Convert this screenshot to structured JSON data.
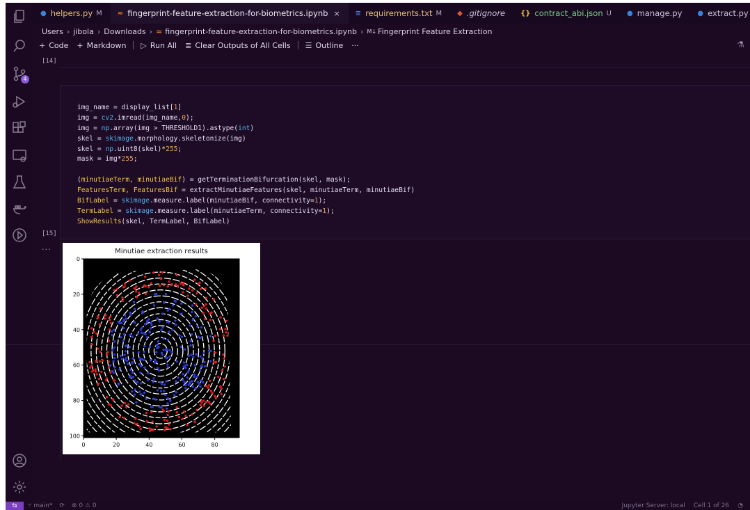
{
  "tabs": [
    {
      "label": "helpers.py",
      "icon": "python-icon",
      "icon_color": "#3b82d6",
      "status": "M",
      "active": false
    },
    {
      "label": "fingerprint-feature-extraction-for-biometrics.ipynb",
      "icon": "jupyter-icon",
      "icon_color": "#e07b2a",
      "status": "",
      "active": true,
      "closable": true
    },
    {
      "label": "requirements.txt",
      "icon": "requirements-icon",
      "icon_color": "#4a7dd4",
      "status": "M",
      "active": false
    },
    {
      "label": ".gitignore",
      "icon": "git-icon",
      "icon_color": "#e0583a",
      "status": "",
      "active": false,
      "italic": true
    },
    {
      "label": "contract_abi.json",
      "icon": "json-icon",
      "icon_color": "#e8c23a",
      "status": "U",
      "active": false
    },
    {
      "label": "manage.py",
      "icon": "python-icon",
      "icon_color": "#3b82d6",
      "status": "",
      "active": false
    },
    {
      "label": "extract.py",
      "icon": "python-icon",
      "icon_color": "#3b82d6",
      "status": "",
      "active": false
    }
  ],
  "tab_close_glyph": "×",
  "breadcrumb": {
    "parts": [
      "Users",
      "jibola",
      "Downloads",
      "fingerprint-feature-extraction-for-biometrics.ipynb"
    ],
    "section_prefix": "M↓",
    "section": "Fingerprint Feature Extraction"
  },
  "toolbar": {
    "code": "Code",
    "markdown": "Markdown",
    "run_all": "Run All",
    "clear": "Clear Outputs of All Cells",
    "outline": "Outline",
    "more": "···"
  },
  "cells": {
    "prompt_14": "[14]",
    "prompt_15": "[15]",
    "output_more": "···"
  },
  "code_lines": [
    "img_name = display_list[1]",
    "img = cv2.imread(img_name,0);",
    "img = np.array(img > THRESHOLD1).astype(int)",
    "skel = skimage.morphology.skeletonize(img)",
    "skel = np.uint8(skel)*255;",
    "mask = img*255;",
    "",
    "(minutiaeTerm, minutiaeBif) = getTerminationBifurcation(skel, mask);",
    "FeaturesTerm, FeaturesBif = extractMinutiaeFeatures(skel, minutiaeTerm, minutiaeBif)",
    "BifLabel = skimage.measure.label(minutiaeBif, connectivity=1);",
    "TermLabel = skimage.measure.label(minutiaeTerm, connectivity=1);",
    "ShowResults(skel, TermLabel, BifLabel)"
  ],
  "activity_badge": "4",
  "status_bar": {
    "branch": "main*",
    "problems": "⊗ 0 ⚠ 0",
    "server": "Jupyter Server: local",
    "cell": "Cell 1 of 26"
  },
  "chart_data": {
    "type": "image",
    "title": "Minutiae extraction results",
    "x_ticks": [
      "0",
      "20",
      "40",
      "60",
      "80"
    ],
    "y_ticks": [
      "0",
      "20",
      "40",
      "60",
      "80",
      "100"
    ],
    "xlim": [
      0,
      95
    ],
    "ylim": [
      101,
      0
    ],
    "colors": {
      "background": "#000000",
      "ridges": "#ffffff",
      "terminations": "#e01818",
      "bifurcations": "#2b3bd8"
    }
  }
}
